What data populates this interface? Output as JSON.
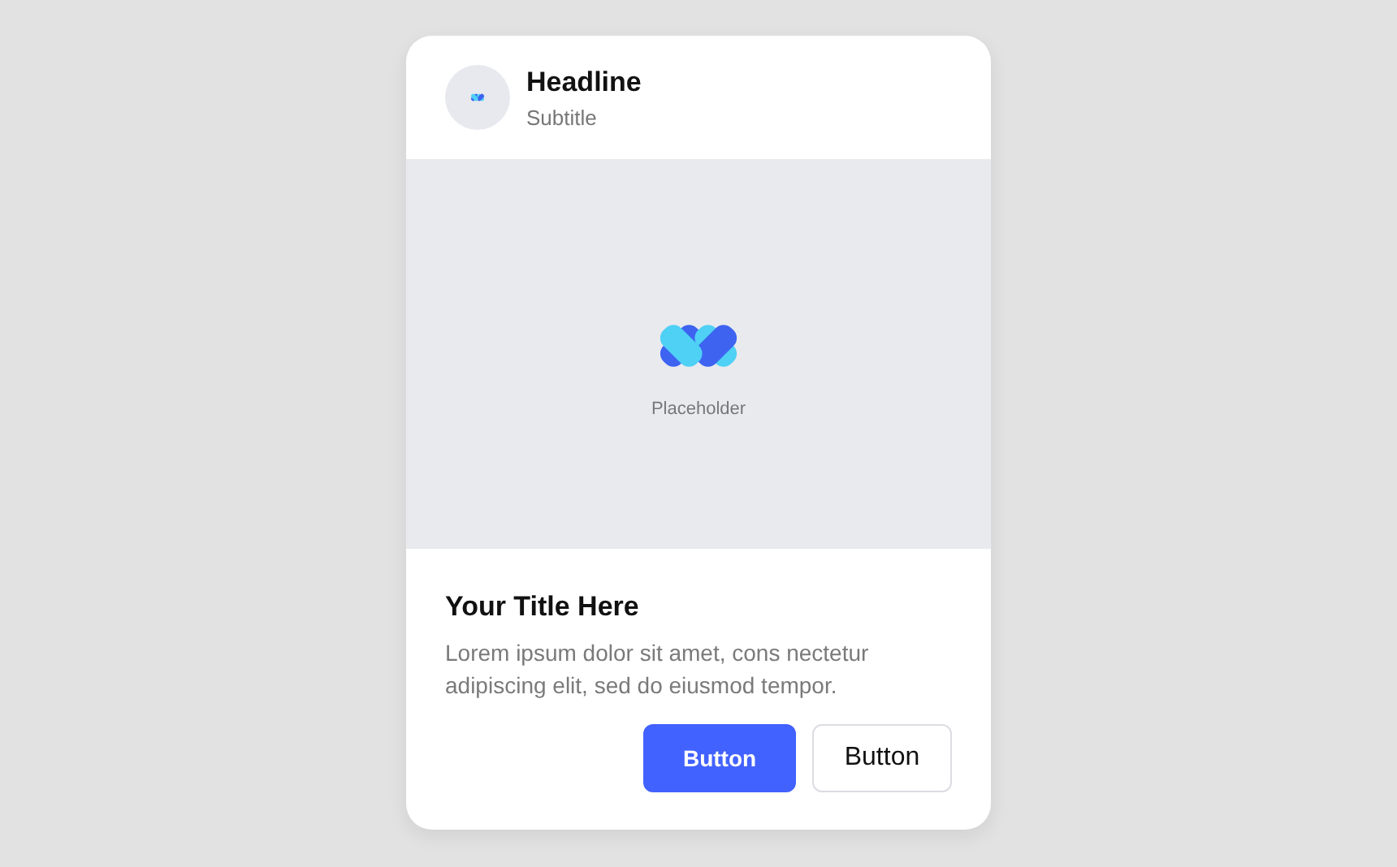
{
  "card": {
    "headline": "Headline",
    "subtitle": "Subtitle",
    "media": {
      "label": "Placeholder"
    },
    "title": "Your Title Here",
    "body": "Lorem ipsum dolor sit amet, cons nectetur adipiscing elit, sed do eiusmod tempor.",
    "buttons": [
      {
        "label": "Button",
        "kind": "primary"
      },
      {
        "label": "Button",
        "kind": "secondary"
      }
    ]
  }
}
